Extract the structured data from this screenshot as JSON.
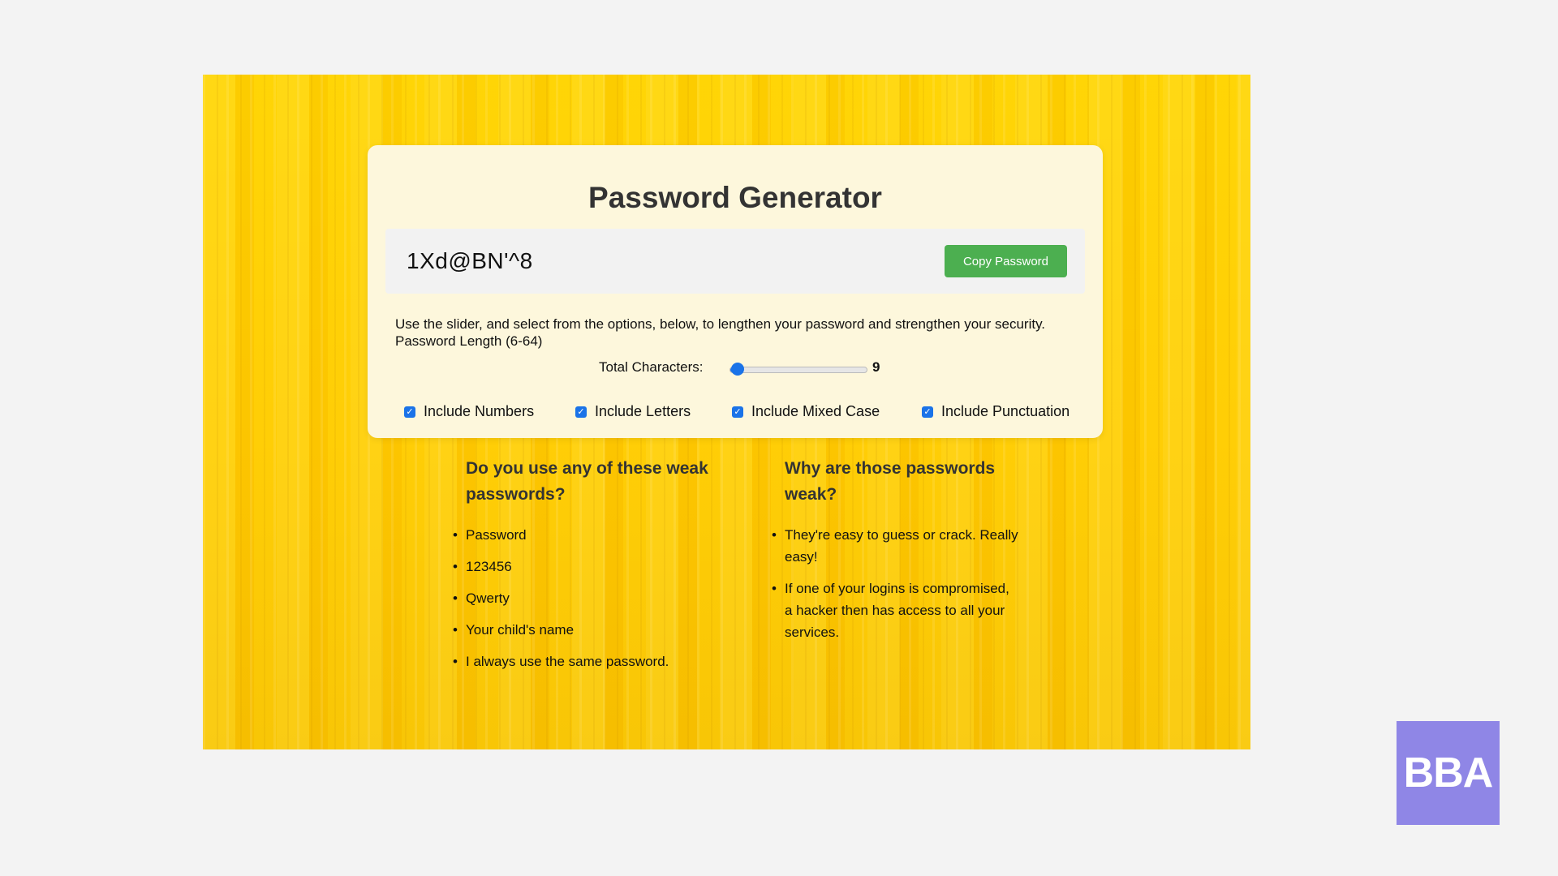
{
  "app": {
    "title": "Password Generator",
    "password": "1Xd@BN'^8",
    "copy_label": "Copy Password",
    "description": "Use the slider, and select from the options, below, to lengthen your password and strengthen your security. Password Length (6-64)",
    "slider": {
      "label": "Total Characters:",
      "value": "9",
      "min": 6,
      "max": 64,
      "current": 9
    },
    "options": [
      {
        "label": "Include Numbers",
        "checked": true
      },
      {
        "label": "Include Letters",
        "checked": true
      },
      {
        "label": "Include Mixed Case",
        "checked": true
      },
      {
        "label": "Include Punctuation",
        "checked": true
      }
    ],
    "weak": {
      "heading": "Do you use any of these weak passwords?",
      "items": [
        "Password",
        "123456",
        "Qwerty",
        "Your child's name",
        "I always use the same password."
      ]
    },
    "why": {
      "heading": "Why are those passwords weak?",
      "items": [
        "They're easy to guess or crack. Really easy!",
        "If one of your logins is compromised, a hacker then has access to all your services."
      ]
    }
  },
  "logo": {
    "text": "BBA"
  },
  "colors": {
    "page_bg": "#f3f3f3",
    "stage_bg": "#ffd400",
    "card_bg": "#fdf7dc",
    "accent": "#1a73e8",
    "button": "#4caf50",
    "logo_bg": "#8f86e6"
  }
}
